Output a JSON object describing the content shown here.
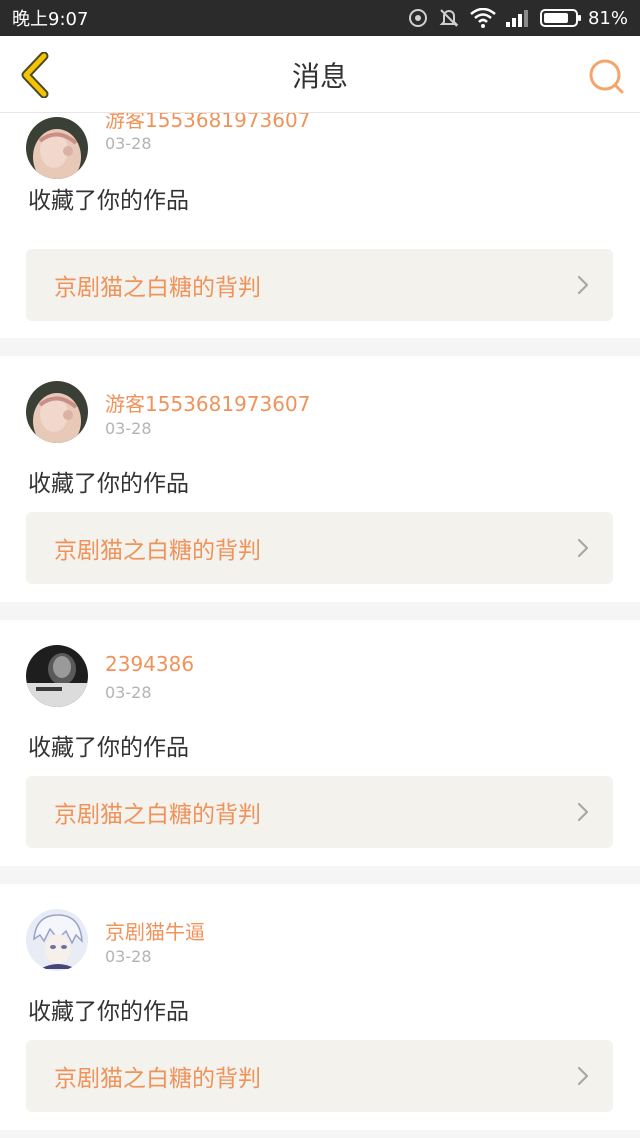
{
  "status_bar": {
    "time": "晚上9:07",
    "battery": "81%",
    "battery_level": 0.81
  },
  "nav": {
    "title": "消息",
    "back_icon": "chevron-left-icon",
    "search_icon": "search-icon",
    "accent_color": "#f5c400",
    "search_color": "#f5a46a"
  },
  "colors": {
    "username": "#f0935a",
    "link_bg": "#f3f2ed",
    "separator": "#f5f5f5"
  },
  "messages": [
    {
      "username": "游客1553681973607",
      "date": "03-28",
      "action": "收藏了你的作品",
      "work_title": "京剧猫之白糖的背判",
      "avatar": "girl-covering-face"
    },
    {
      "username": "游客1553681973607",
      "date": "03-28",
      "action": "收藏了你的作品",
      "work_title": "京剧猫之白糖的背判",
      "avatar": "girl-covering-face"
    },
    {
      "username": "2394386",
      "date": "03-28",
      "action": "收藏了你的作品",
      "work_title": "京剧猫之白糖的背判",
      "avatar": "dark-portrait"
    },
    {
      "username": "京剧猫牛逼",
      "date": "03-28",
      "action": "收藏了你的作品",
      "work_title": "京剧猫之白糖的背判",
      "avatar": "anime-character"
    }
  ]
}
